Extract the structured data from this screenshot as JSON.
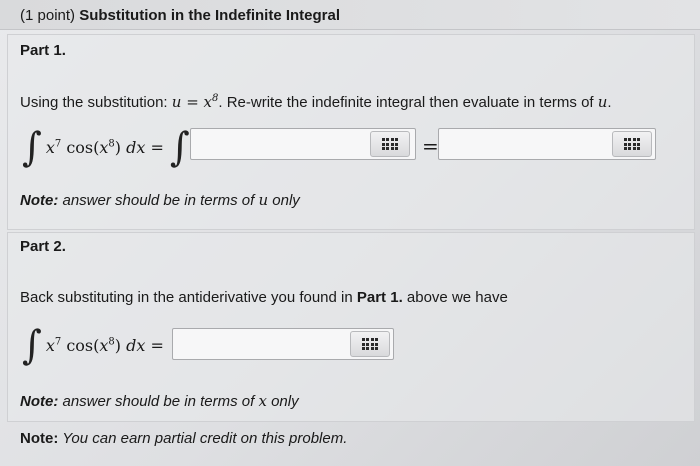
{
  "header": {
    "points": "(1 point)",
    "title": "Substitution in the Indefinite Integral"
  },
  "part1": {
    "title": "Part 1.",
    "instruction_prefix": "Using the substitution: ",
    "substitution": "u = x",
    "substitution_exp": "8",
    "instruction_suffix": ". Re-write the indefinite integral then evaluate in terms of ",
    "instruction_var": "u",
    "instruction_end": ".",
    "integrand_base": "x",
    "integrand_exp": "7",
    "integrand_func": "cos",
    "integrand_inner": "x",
    "integrand_inner_exp": "8",
    "differential": "dx",
    "equals": "=",
    "answer_u_integral": "",
    "answer_u_eval": "",
    "note_label": "Note:",
    "note_text": " answer should be in terms of ",
    "note_var": "u",
    "note_end": " only"
  },
  "part2": {
    "title": "Part 2.",
    "instruction_prefix": "Back substituting in the antiderivative you found in ",
    "instruction_ref": "Part 1.",
    "instruction_suffix": " above we have",
    "answer_x": "",
    "note_label": "Note:",
    "note_text": " answer should be in terms of ",
    "note_var": "x",
    "note_end": " only"
  },
  "footer_note": {
    "label": "Note:",
    "text": " You can earn partial credit on this problem."
  },
  "icons": {
    "palette": "equation-palette-icon",
    "integral": "integral-sign-icon"
  }
}
